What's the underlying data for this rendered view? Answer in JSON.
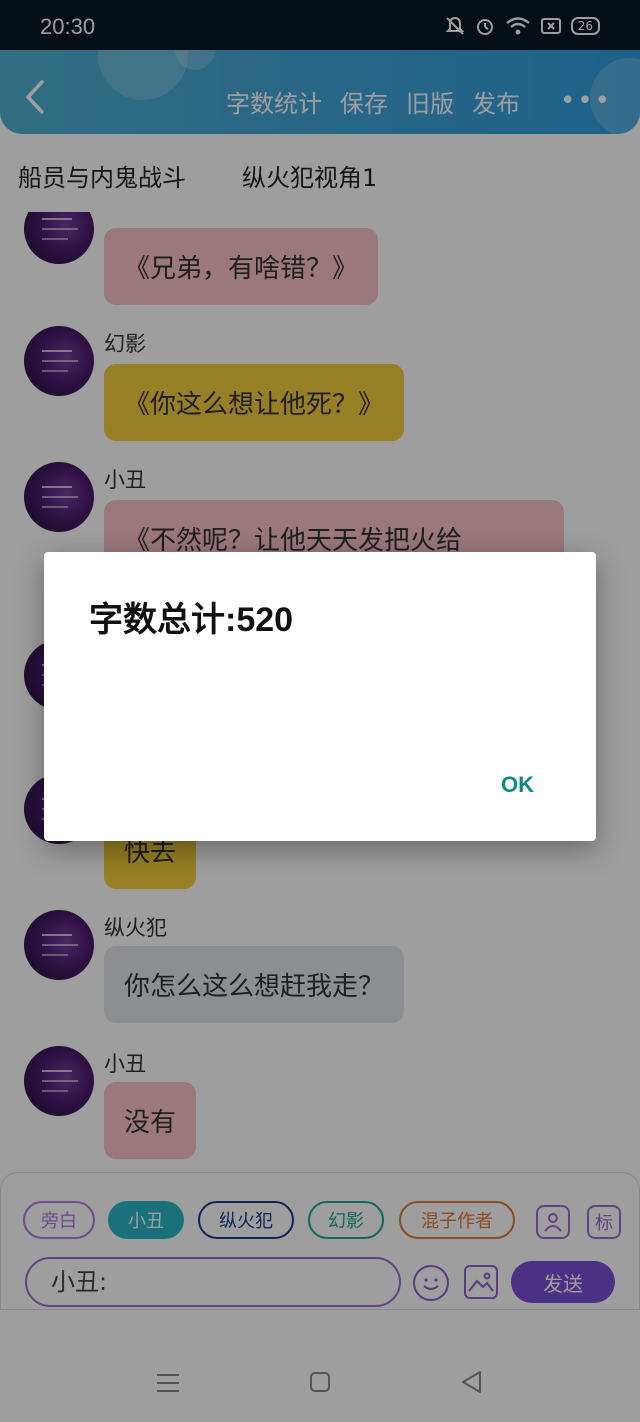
{
  "status_bar": {
    "time": "20:30",
    "battery": "26"
  },
  "header": {
    "menu": [
      {
        "label": "字数统计"
      },
      {
        "label": "保存"
      },
      {
        "label": "旧版"
      },
      {
        "label": "发布"
      }
    ],
    "more": "•••"
  },
  "tabs": [
    {
      "label": "船员与内鬼战斗"
    },
    {
      "label": "纵火犯视角1"
    }
  ],
  "chat": {
    "messages": [
      {
        "name": "",
        "text": "《兄弟，有啥错？》",
        "color": "#f8c2c8"
      },
      {
        "name": "幻影",
        "text": "《你这么想让他死？》",
        "color": "#f3cd3a"
      },
      {
        "name": "小丑",
        "text": "《不然呢？让他天天发把火给",
        "color": "#f8c2c8"
      },
      {
        "name": "",
        "text": "",
        "color": ""
      },
      {
        "name": "",
        "text": "快去",
        "color": "#f3cd3a"
      },
      {
        "name": "纵火犯",
        "text": "你怎么这么想赶我走？",
        "color": "#e3e6ec"
      },
      {
        "name": "小丑",
        "text": "没有",
        "color": "#f8c2c8"
      }
    ]
  },
  "composer": {
    "roles": [
      {
        "label": "旁白",
        "border": "#b07be0",
        "text_color": "#b07be0",
        "bg": "#ffffff"
      },
      {
        "label": "小丑",
        "border": "#2bb7c9",
        "text_color": "#ffffff",
        "bg": "#2bb7c9"
      },
      {
        "label": "纵火犯",
        "border": "#1b3c8e",
        "text_color": "#1b3c8e",
        "bg": "#ffffff"
      },
      {
        "label": "幻影",
        "border": "#1fa794",
        "text_color": "#1fa794",
        "bg": "#ffffff"
      },
      {
        "label": "混子作者",
        "border": "#e07b3a",
        "text_color": "#e07b3a",
        "bg": "#ffffff"
      }
    ],
    "tag_button": "标",
    "input_value": "小丑:",
    "send_label": "发送"
  },
  "dialog": {
    "title": "字数总计:520",
    "ok_label": "OK"
  },
  "colors": {
    "header_gradient_start": "#4fb2d1",
    "header_gradient_end": "#2f9ee0",
    "send_button": "#7a50d6",
    "dialog_ok": "#138a7e"
  }
}
